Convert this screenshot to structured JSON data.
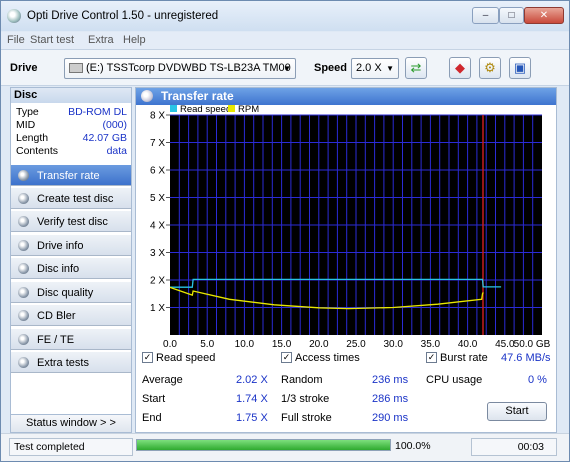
{
  "window": {
    "title": "Opti Drive Control 1.50 - unregistered"
  },
  "menu": [
    "File",
    "Start test",
    "Extra",
    "Help"
  ],
  "toolbar": {
    "drive_label": "Drive",
    "drive_value": "(E:)  TSSTcorp DVDWBD TS-LB23A TM00",
    "speed_label": "Speed",
    "speed_value": "2.0 X"
  },
  "disc": {
    "header": "Disc",
    "rows": [
      {
        "key": "Type",
        "value": "BD-ROM DL"
      },
      {
        "key": "MID",
        "value": "(000)"
      },
      {
        "key": "Length",
        "value": "42.07 GB"
      },
      {
        "key": "Contents",
        "value": "data"
      }
    ]
  },
  "nav": [
    {
      "label": "Transfer rate",
      "selected": true
    },
    {
      "label": "Create test disc"
    },
    {
      "label": "Verify test disc"
    },
    {
      "label": "Drive info"
    },
    {
      "label": "Disc info"
    },
    {
      "label": "Disc quality"
    },
    {
      "label": "CD Bler"
    },
    {
      "label": "FE / TE"
    },
    {
      "label": "Extra tests"
    }
  ],
  "status_window_label": "Status window > >",
  "panel": {
    "title": "Transfer rate"
  },
  "chart_data": {
    "type": "line",
    "legend": [
      "Read speed",
      "RPM"
    ],
    "colors": {
      "read_speed": "#29c4e6",
      "rpm": "#e8e800",
      "marker": "#c81e1e",
      "grid": "#2b2bd6",
      "background": "#000000"
    },
    "x_ticks": [
      "0.0",
      "5.0",
      "10.0",
      "15.0",
      "20.0",
      "25.0",
      "30.0",
      "35.0",
      "40.0",
      "45.0",
      "50.0 GB"
    ],
    "y_ticks": [
      "1 X",
      "2 X",
      "3 X",
      "4 X",
      "5 X",
      "6 X",
      "7 X",
      "8 X"
    ],
    "xlim": [
      0,
      50
    ],
    "ylim": [
      0,
      8
    ],
    "marker_x": 42.07,
    "series": [
      {
        "name": "Read speed",
        "x": [
          0,
          3,
          3.1,
          42,
          42.1,
          44.5
        ],
        "y": [
          1.74,
          1.74,
          2.02,
          2.02,
          1.75,
          1.75
        ]
      },
      {
        "name": "RPM",
        "x": [
          0,
          3,
          3.1,
          8,
          14,
          20,
          24,
          30,
          36,
          41.9,
          42,
          42.1
        ],
        "y": [
          1.73,
          1.45,
          1.6,
          1.3,
          1.1,
          0.99,
          0.96,
          1.0,
          1.12,
          1.3,
          1.5,
          1.55
        ]
      }
    ]
  },
  "options": {
    "read_speed": {
      "label": "Read speed",
      "checked": true
    },
    "access_times": {
      "label": "Access times",
      "checked": true
    },
    "burst_rate": {
      "label": "Burst rate",
      "checked": true,
      "value": "47.6 MB/s"
    }
  },
  "stats": {
    "average": {
      "label": "Average",
      "value": "2.02 X"
    },
    "start": {
      "label": "Start",
      "value": "1.74 X"
    },
    "end": {
      "label": "End",
      "value": "1.75 X"
    },
    "random": {
      "label": "Random",
      "value": "236 ms"
    },
    "one_third": {
      "label": "1/3 stroke",
      "value": "286 ms"
    },
    "full": {
      "label": "Full stroke",
      "value": "290 ms"
    },
    "cpu": {
      "label": "CPU usage",
      "value": "0 %"
    }
  },
  "start_button": "Start",
  "statusbar": {
    "text": "Test completed",
    "progress": 1.0,
    "progress_label": "100.0%",
    "time": "00:03"
  }
}
